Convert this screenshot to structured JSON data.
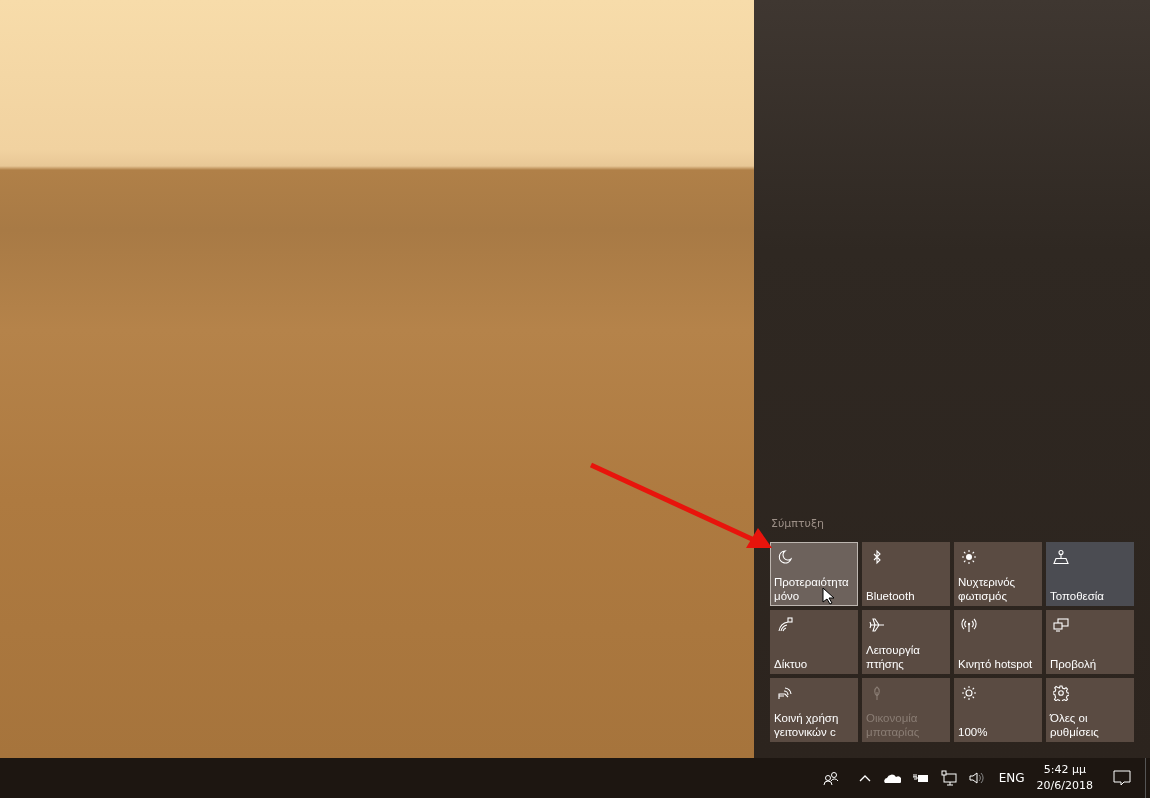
{
  "action_center": {
    "collapse_label": "Σύμπτυξη",
    "tiles": [
      {
        "label": "Προτεραιότητα\nμόνο",
        "on": false,
        "hovered": true,
        "disabled": false
      },
      {
        "label": "Bluetooth",
        "on": false,
        "hovered": false,
        "disabled": false
      },
      {
        "label": "Νυχτερινός\nφωτισμός",
        "on": false,
        "hovered": false,
        "disabled": false
      },
      {
        "label": "Τοποθεσία",
        "on": true,
        "hovered": false,
        "disabled": false
      },
      {
        "label": "Δίκτυο",
        "on": false,
        "hovered": false,
        "disabled": false
      },
      {
        "label": "Λειτουργία\nπτήσης",
        "on": false,
        "hovered": false,
        "disabled": false
      },
      {
        "label": "Κινητό hotspot",
        "on": false,
        "hovered": false,
        "disabled": false
      },
      {
        "label": "Προβολή",
        "on": false,
        "hovered": false,
        "disabled": false
      },
      {
        "label": "Κοινή χρήση\nγειτονικών c",
        "on": false,
        "hovered": false,
        "disabled": false
      },
      {
        "label": "Οικονομία\nμπαταρίας",
        "on": false,
        "hovered": false,
        "disabled": true
      },
      {
        "label": "100%",
        "on": false,
        "hovered": false,
        "disabled": false
      },
      {
        "label": "Όλες οι\nρυθμίσεις",
        "on": false,
        "hovered": false,
        "disabled": false
      }
    ]
  },
  "taskbar": {
    "language": "ENG",
    "time": "5:42 μμ",
    "date": "20/6/2018"
  }
}
